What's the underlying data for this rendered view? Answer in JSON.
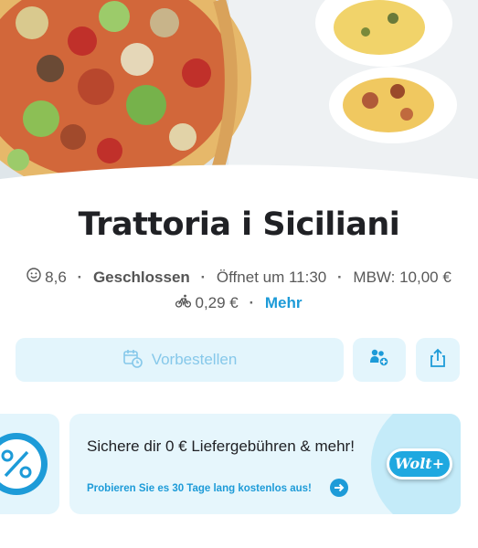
{
  "restaurant": {
    "name": "Trattoria i Siciliani",
    "rating": "8,6",
    "status": "Geschlossen",
    "opens": "Öffnet um 11:30",
    "min_order": "MBW: 10,00 €",
    "delivery_fee": "0,29 €",
    "more_label": "Mehr"
  },
  "actions": {
    "preorder_label": "Vorbestellen"
  },
  "promo": {
    "title": "Sichere dir 0 € Liefergebühren & mehr!",
    "subtitle": "Probieren Sie es 30 Tage lang kostenlos aus!",
    "badge": "Wolt+"
  },
  "colors": {
    "accent": "#1d9bd8",
    "button_bg": "#e3f5fc",
    "button_text": "#86c8ea"
  },
  "icons": {
    "rating": "smiley-icon",
    "delivery": "bike-icon",
    "preorder": "calendar-clock-icon",
    "group": "group-order-icon",
    "share": "share-icon",
    "promo_left": "percent-badge-icon",
    "promo_arrow": "arrow-right-icon"
  }
}
